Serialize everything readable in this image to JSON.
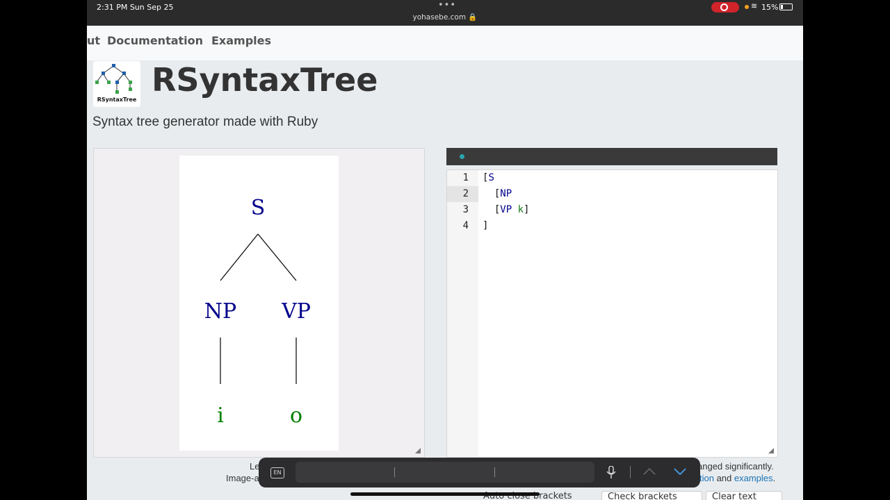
{
  "status_bar": {
    "time": "2:31 PM   Sun Sep 25",
    "url": "yohasebe.com 🔒",
    "battery": "15%"
  },
  "nav": {
    "items": [
      "ut",
      "Documentation",
      "Examples"
    ]
  },
  "header": {
    "logo_text": "RSyntaxTree",
    "title": "RSyntaxTree",
    "subtitle": "Syntax tree generator made with Ruby"
  },
  "tree": {
    "root": "S",
    "left_node": "NP",
    "right_node": "VP",
    "left_leaf": "i",
    "right_leaf": "o",
    "node_color": "#00008b",
    "leaf_color": "#008000"
  },
  "editor": {
    "line_numbers": [
      "1",
      "2",
      "3",
      "4"
    ],
    "lines": {
      "l1_bracket": "[",
      "l1_kw": "S",
      "l2_bracket": "  [",
      "l2_kw": "NP",
      "l3_bracket": "  [",
      "l3_kw": "VP",
      "l3_leaf": "k",
      "l3_close": "]",
      "l4": "]"
    }
  },
  "footer": {
    "left1": "Le",
    "left2": "Image-a",
    "right1": "anged significantly.",
    "right2_link1": "tion",
    "right2_and": " and ",
    "right2_link2": "examples",
    "right2_end": ".",
    "checkbox_partial": "Auto close brackets",
    "btn2_partial": "Check brackets",
    "btn3_partial": "Clear text"
  },
  "keyboard": {
    "lang": "EN"
  }
}
